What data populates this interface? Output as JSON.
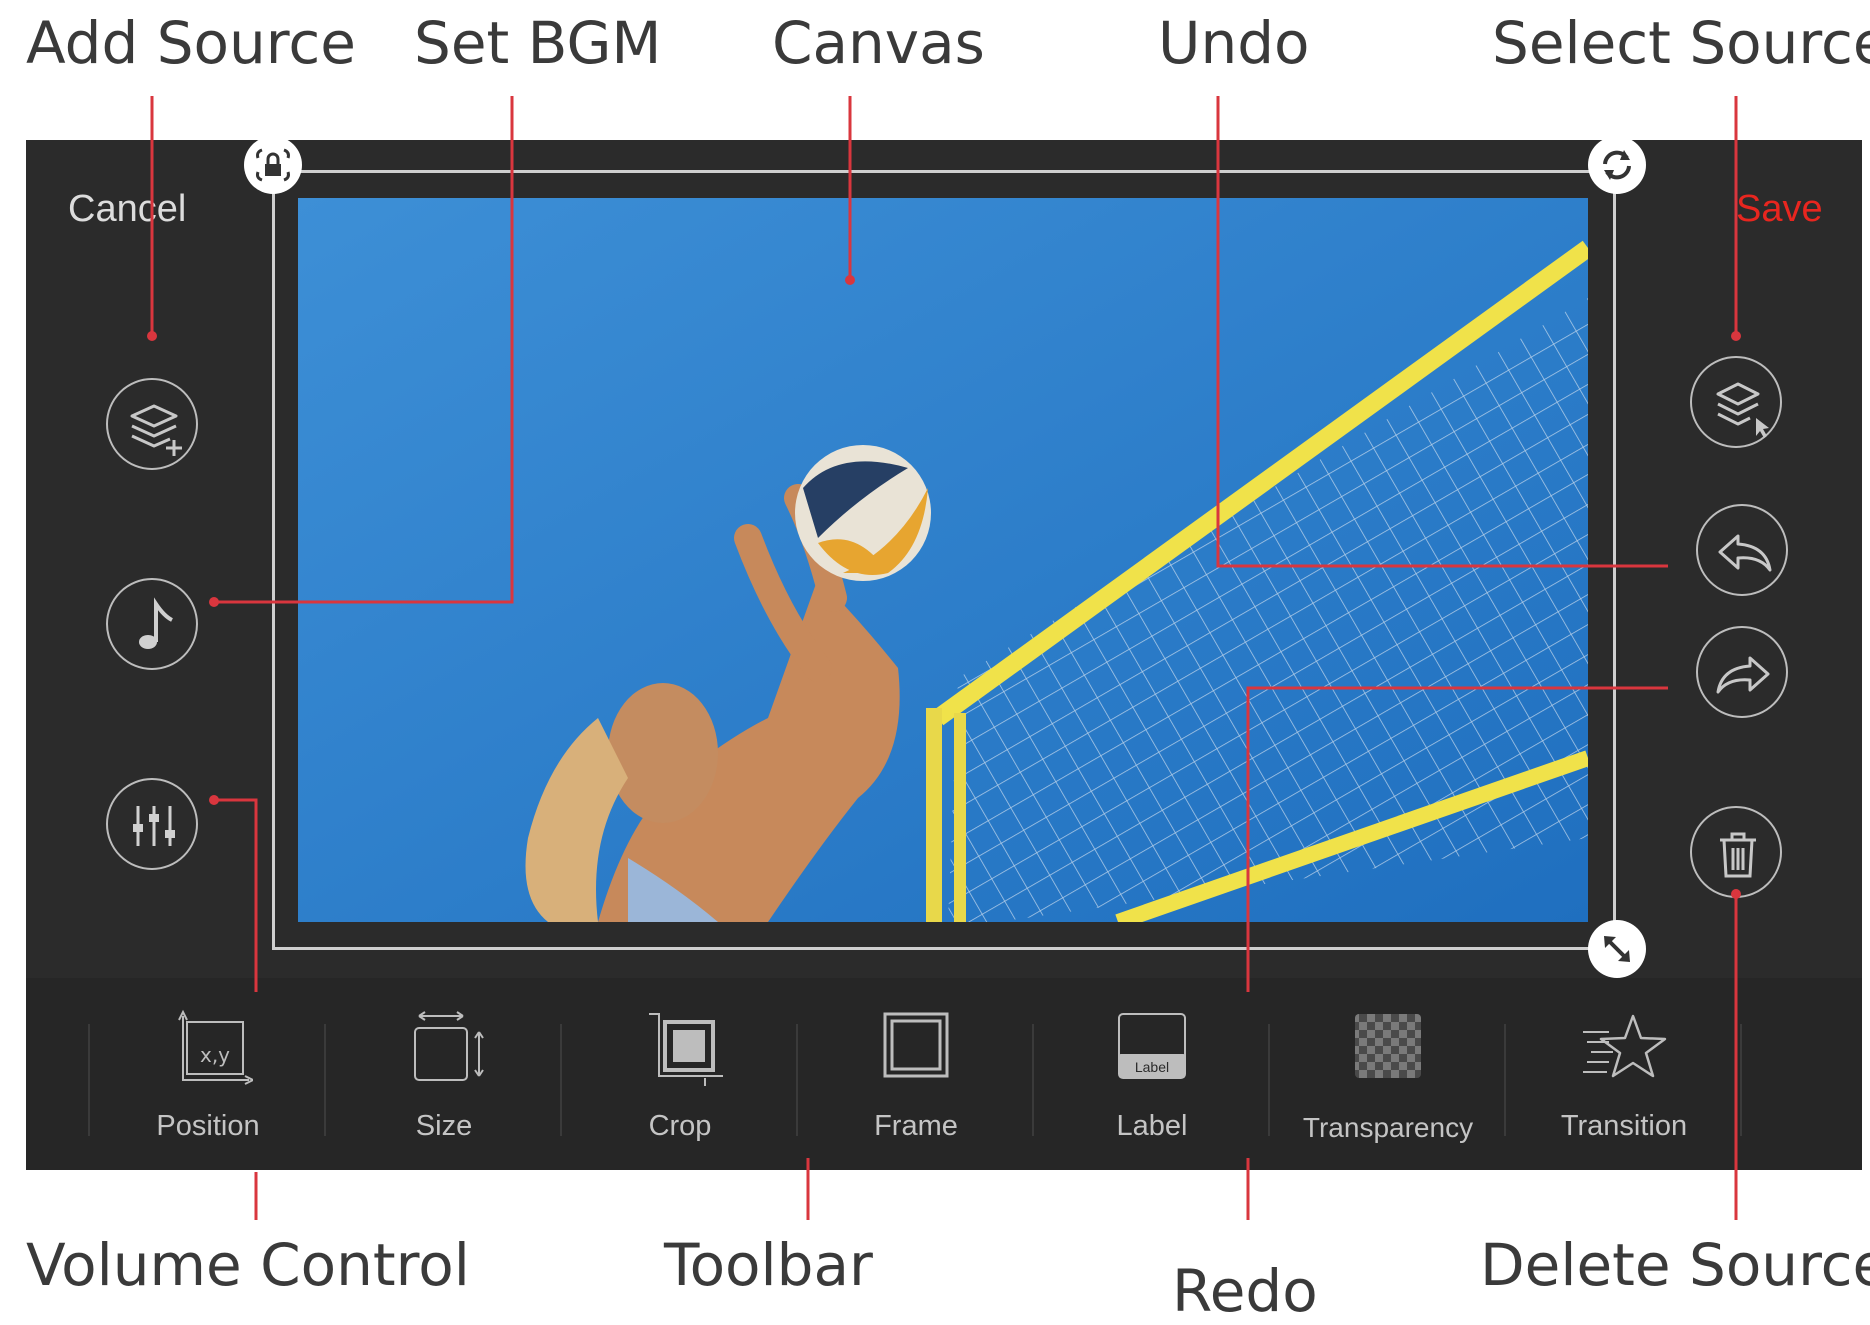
{
  "callouts": {
    "add_source": "Add Source",
    "set_bgm": "Set BGM",
    "canvas": "Canvas",
    "undo": "Undo",
    "select_source": "Select Source",
    "volume_control": "Volume Control",
    "toolbar": "Toolbar",
    "redo": "Redo",
    "delete_source": "Delete Source"
  },
  "app": {
    "cancel_label": "Cancel",
    "save_label": "Save",
    "left_buttons": [
      "add-source-icon",
      "music-note-icon",
      "equalizer-icon"
    ],
    "right_buttons": [
      "select-layer-icon",
      "undo-icon",
      "redo-icon",
      "trash-icon"
    ],
    "canvas_handles": [
      "lock-icon",
      "rotate-icon",
      "resize-icon"
    ]
  },
  "toolbar": {
    "items": [
      {
        "label": "Position",
        "icon": "position-icon"
      },
      {
        "label": "Size",
        "icon": "size-icon"
      },
      {
        "label": "Crop",
        "icon": "crop-icon"
      },
      {
        "label": "Frame",
        "icon": "frame-icon"
      },
      {
        "label": "Label",
        "icon": "label-icon",
        "icon_text": "Label"
      },
      {
        "label": "Transparency",
        "icon": "transparency-icon"
      },
      {
        "label": "Transition",
        "icon": "transition-icon"
      }
    ],
    "position_icon_text": "x,y"
  },
  "colors": {
    "leader_line": "#d9363e",
    "save_text": "#e8261f",
    "app_background": "#2b2b2b",
    "toolbar_background": "#262626"
  }
}
